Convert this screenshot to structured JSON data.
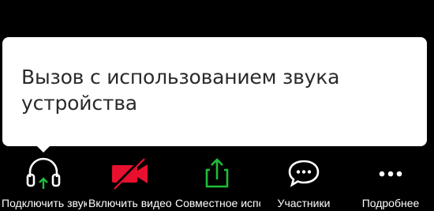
{
  "tooltip": {
    "line1": "Вызов с использованием звука",
    "line2": "устройства"
  },
  "toolbar": {
    "items": [
      {
        "label": "Подключить звук",
        "icon": "headphones-icon"
      },
      {
        "label": "Включить видео",
        "icon": "video-off-icon"
      },
      {
        "label": "Совместное использование",
        "icon": "share-icon"
      },
      {
        "label": "Участники",
        "icon": "participants-chat-icon"
      },
      {
        "label": "Подробнее",
        "icon": "more-icon"
      }
    ]
  },
  "colors": {
    "background": "#000000",
    "tooltip_bg": "#ffffff",
    "accent_green": "#1fbe3b",
    "video_red": "#e8102e"
  }
}
